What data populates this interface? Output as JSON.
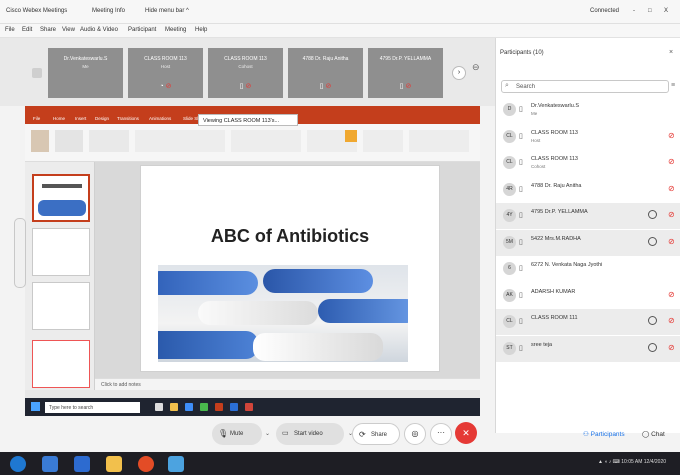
{
  "titlebar": {
    "items": [
      "Cisco Webex Meetings",
      "Meeting Info",
      "Hide menu bar ^"
    ],
    "status": "Connected",
    "controls": [
      "-",
      "□",
      "X"
    ]
  },
  "menubar": [
    "File",
    "Edit",
    "Share",
    "View",
    "Audio & Video",
    "Participant",
    "Meeting",
    "Help"
  ],
  "video_strip": [
    {
      "name": "Dr.Venkateswarlu.S",
      "role": "Me"
    },
    {
      "name": "CLASS ROOM 113",
      "role": "Host"
    },
    {
      "name": "CLASS ROOM 113",
      "role": "Cohost"
    },
    {
      "name": "4788 Dr. Raju Anitha",
      "role": ""
    },
    {
      "name": "4795 Dr.P. YELLAMMA",
      "role": ""
    }
  ],
  "share": {
    "viewing_label": "Viewing CLASS ROOM 113's...",
    "ppt_tabs": [
      "File",
      "Home",
      "Insert",
      "Design",
      "Transitions",
      "Animations",
      "Slide Show",
      "Review",
      "View"
    ],
    "slide_title": "ABC of Antibiotics",
    "notes_placeholder": "Click to add notes",
    "search_placeholder": "Type here to search"
  },
  "participants_panel": {
    "title": "Participants (10)",
    "search_placeholder": "Search",
    "list": [
      {
        "initials": "D",
        "name": "Dr.Venkateswarlu.S",
        "role": "Me",
        "muted": false,
        "highlight": false
      },
      {
        "initials": "CL",
        "name": "CLASS ROOM 113",
        "role": "Host",
        "muted": true,
        "highlight": false
      },
      {
        "initials": "CL",
        "name": "CLASS ROOM 113",
        "role": "Cohost",
        "muted": true,
        "highlight": false
      },
      {
        "initials": "4R",
        "name": "4788 Dr. Raju Anitha",
        "role": "",
        "muted": true,
        "highlight": false
      },
      {
        "initials": "4Y",
        "name": "4795 Dr.P. YELLAMMA",
        "role": "",
        "muted": true,
        "highlight": true
      },
      {
        "initials": "5M",
        "name": "5422 Mrs.M.RADHA",
        "role": "",
        "muted": true,
        "highlight": true
      },
      {
        "initials": "6",
        "name": "6272 N. Venkata Naga Jyothi",
        "role": "",
        "muted": false,
        "highlight": false
      },
      {
        "initials": "AK",
        "name": "ADARSH KUMAR",
        "role": "",
        "muted": true,
        "highlight": false
      },
      {
        "initials": "CL",
        "name": "CLASS ROOM 111",
        "role": "",
        "muted": true,
        "highlight": true
      },
      {
        "initials": "ST",
        "name": "sree teja",
        "role": "",
        "muted": true,
        "highlight": true
      }
    ]
  },
  "controls": {
    "mute": "Mute",
    "start_video": "Start video",
    "share": "Share",
    "participants": "Participants",
    "chat": "Chat"
  },
  "colors": {
    "accent": "#e53935",
    "ppt": "#c43e1c",
    "webex_blue": "#1a73e8"
  },
  "tray": {
    "time": "10:05 AM",
    "date": "12/4/2020"
  }
}
